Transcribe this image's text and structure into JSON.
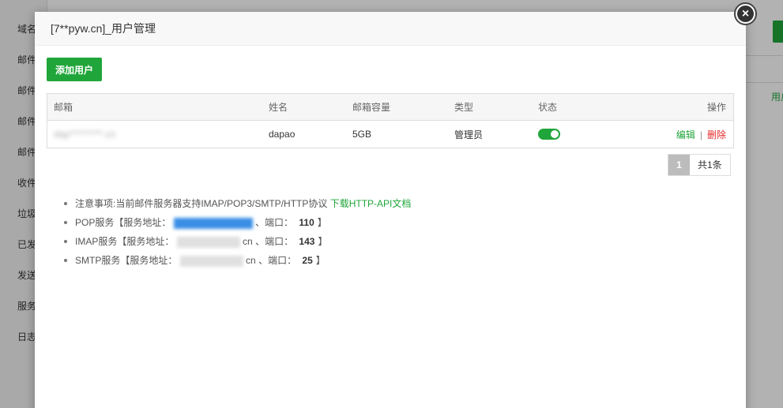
{
  "background": {
    "sidebar_items": [
      "域名",
      "邮件",
      "邮件",
      "邮件",
      "邮件",
      "收件",
      "垃圾",
      "已发",
      "发送",
      "服务",
      "日志"
    ],
    "right_link": "用户"
  },
  "modal": {
    "title": "[7**pyw.cn]_用户管理",
    "close_icon": "close-icon",
    "add_button": "添加用户",
    "table": {
      "headers": [
        "邮箱",
        "姓名",
        "邮箱容量",
        "类型",
        "状态",
        "操作"
      ],
      "rows": [
        {
          "email": "dap*********.cn",
          "name": "dapao",
          "capacity": "5GB",
          "type": "管理员",
          "status_on": true,
          "edit": "编辑",
          "sep": "|",
          "delete": "删除"
        }
      ]
    },
    "pager": {
      "page": "1",
      "total": "共1条"
    },
    "notes": {
      "n1_text": "注意事项:当前邮件服务器支持IMAP/POP3/SMTP/HTTP协议",
      "n1_link": "下载HTTP-API文档",
      "pop_prefix": "POP服务【服务地址：",
      "pop_port_label": "、端口：",
      "pop_port": "110",
      "imap_prefix": "IMAP服务【服务地址：",
      "imap_addr_tail": "cn",
      "imap_port_label": "、端口：",
      "imap_port": "143",
      "smtp_prefix": "SMTP服务【服务地址：",
      "smtp_addr_tail": "cn",
      "smtp_port_label": "、端口：",
      "smtp_port": "25",
      "close_bracket": "】"
    }
  },
  "colors": {
    "accent": "#20a53a",
    "danger": "#e82a2a"
  }
}
